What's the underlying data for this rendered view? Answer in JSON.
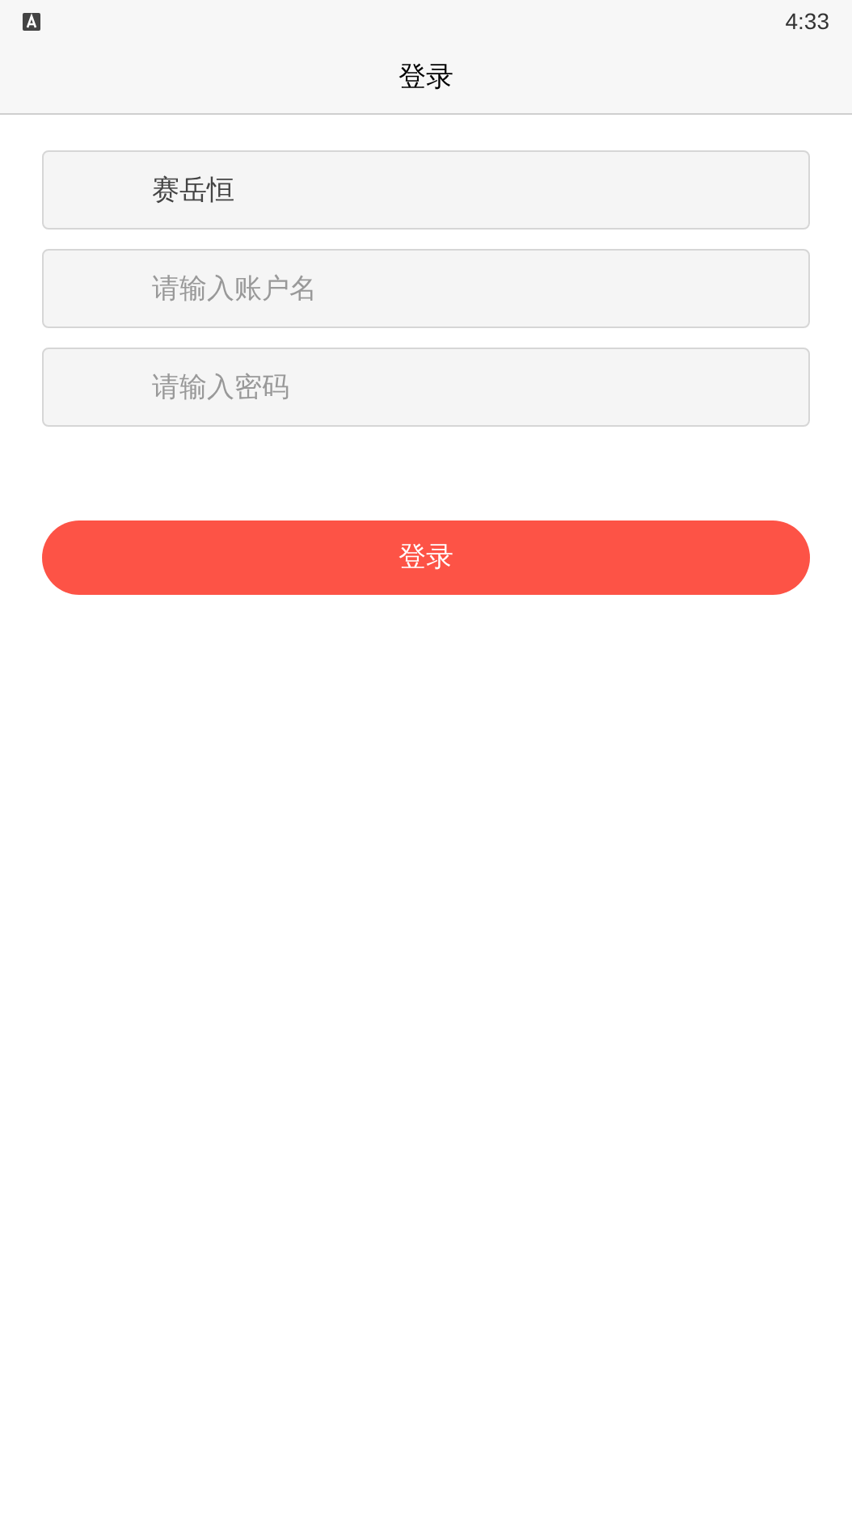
{
  "status_bar": {
    "time": "4:33"
  },
  "header": {
    "title": "登录"
  },
  "fields": [
    {
      "value": "赛岳恒"
    },
    {
      "placeholder": "请输入账户名"
    },
    {
      "placeholder": "请输入密码"
    }
  ],
  "login_button": {
    "label": "登录"
  }
}
